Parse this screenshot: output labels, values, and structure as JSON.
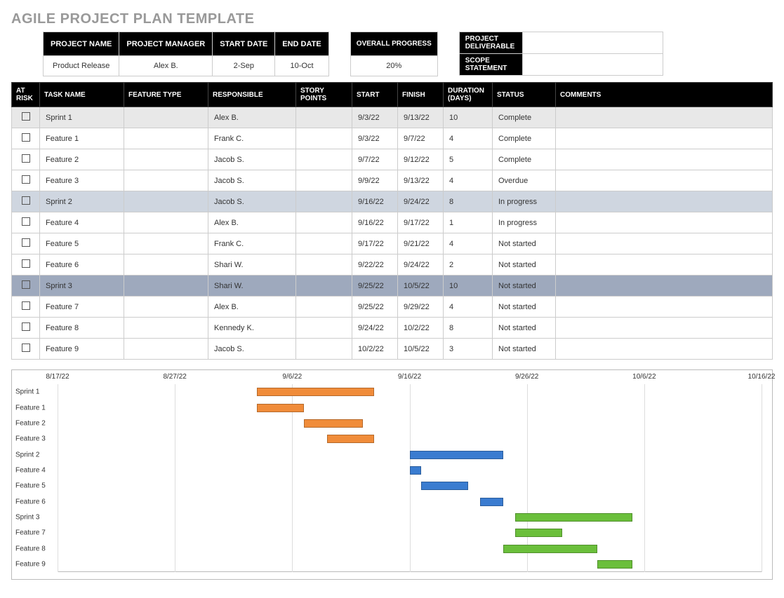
{
  "title": "AGILE PROJECT PLAN TEMPLATE",
  "info": {
    "headers": {
      "project_name": "PROJECT NAME",
      "project_manager": "PROJECT MANAGER",
      "start_date": "START DATE",
      "end_date": "END DATE"
    },
    "project_name": "Product Release",
    "project_manager": "Alex B.",
    "start_date": "2-Sep",
    "end_date": "10-Oct",
    "overall_label": "OVERALL PROGRESS",
    "overall_value": "20%",
    "deliverable_label": "PROJECT DELIVERABLE",
    "deliverable_value": "",
    "scope_label": "SCOPE STATEMENT",
    "scope_value": ""
  },
  "columns": {
    "at_risk": "AT RISK",
    "task_name": "TASK NAME",
    "feature_type": "FEATURE TYPE",
    "responsible": "RESPONSIBLE",
    "story_points": "STORY POINTS",
    "start": "START",
    "finish": "FINISH",
    "duration": "DURATION (DAYS)",
    "status": "STATUS",
    "comments": "COMMENTS"
  },
  "tasks": [
    {
      "cls": "sprint1",
      "task": "Sprint 1",
      "ftype": "",
      "resp": "Alex B.",
      "sp": "",
      "start": "9/3/22",
      "finish": "9/13/22",
      "dur": "10",
      "status": "Complete",
      "comments": ""
    },
    {
      "cls": "",
      "task": "Feature 1",
      "ftype": "",
      "resp": "Frank C.",
      "sp": "",
      "start": "9/3/22",
      "finish": "9/7/22",
      "dur": "4",
      "status": "Complete",
      "comments": ""
    },
    {
      "cls": "",
      "task": "Feature 2",
      "ftype": "",
      "resp": "Jacob S.",
      "sp": "",
      "start": "9/7/22",
      "finish": "9/12/22",
      "dur": "5",
      "status": "Complete",
      "comments": ""
    },
    {
      "cls": "",
      "task": "Feature 3",
      "ftype": "",
      "resp": "Jacob S.",
      "sp": "",
      "start": "9/9/22",
      "finish": "9/13/22",
      "dur": "4",
      "status": "Overdue",
      "comments": ""
    },
    {
      "cls": "sprint2",
      "task": "Sprint 2",
      "ftype": "",
      "resp": "Jacob S.",
      "sp": "",
      "start": "9/16/22",
      "finish": "9/24/22",
      "dur": "8",
      "status": "In progress",
      "comments": ""
    },
    {
      "cls": "",
      "task": "Feature 4",
      "ftype": "",
      "resp": "Alex B.",
      "sp": "",
      "start": "9/16/22",
      "finish": "9/17/22",
      "dur": "1",
      "status": "In progress",
      "comments": ""
    },
    {
      "cls": "",
      "task": "Feature 5",
      "ftype": "",
      "resp": "Frank C.",
      "sp": "",
      "start": "9/17/22",
      "finish": "9/21/22",
      "dur": "4",
      "status": "Not started",
      "comments": ""
    },
    {
      "cls": "",
      "task": "Feature 6",
      "ftype": "",
      "resp": "Shari W.",
      "sp": "",
      "start": "9/22/22",
      "finish": "9/24/22",
      "dur": "2",
      "status": "Not started",
      "comments": ""
    },
    {
      "cls": "sprint3",
      "task": "Sprint 3",
      "ftype": "",
      "resp": "Shari W.",
      "sp": "",
      "start": "9/25/22",
      "finish": "10/5/22",
      "dur": "10",
      "status": "Not started",
      "comments": ""
    },
    {
      "cls": "",
      "task": "Feature 7",
      "ftype": "",
      "resp": "Alex B.",
      "sp": "",
      "start": "9/25/22",
      "finish": "9/29/22",
      "dur": "4",
      "status": "Not started",
      "comments": ""
    },
    {
      "cls": "",
      "task": "Feature 8",
      "ftype": "",
      "resp": "Kennedy K.",
      "sp": "",
      "start": "9/24/22",
      "finish": "10/2/22",
      "dur": "8",
      "status": "Not started",
      "comments": ""
    },
    {
      "cls": "",
      "task": "Feature 9",
      "ftype": "",
      "resp": "Jacob S.",
      "sp": "",
      "start": "10/2/22",
      "finish": "10/5/22",
      "dur": "3",
      "status": "Not started",
      "comments": ""
    }
  ],
  "chart_data": {
    "type": "gantt",
    "x_axis": {
      "min": "8/17/22",
      "max": "10/16/22",
      "ticks": [
        "8/17/22",
        "8/27/22",
        "9/6/22",
        "9/16/22",
        "9/26/22",
        "10/6/22",
        "10/16/22"
      ]
    },
    "colors": {
      "orange": "#f08c3a",
      "blue": "#3a7cd0",
      "green": "#6bbf3b"
    },
    "bars": [
      {
        "label": "Sprint 1",
        "start": "9/3/22",
        "end": "9/13/22",
        "color": "orange"
      },
      {
        "label": "Feature 1",
        "start": "9/3/22",
        "end": "9/7/22",
        "color": "orange"
      },
      {
        "label": "Feature 2",
        "start": "9/7/22",
        "end": "9/12/22",
        "color": "orange"
      },
      {
        "label": "Feature 3",
        "start": "9/9/22",
        "end": "9/13/22",
        "color": "orange"
      },
      {
        "label": "Sprint 2",
        "start": "9/16/22",
        "end": "9/24/22",
        "color": "blue"
      },
      {
        "label": "Feature 4",
        "start": "9/16/22",
        "end": "9/17/22",
        "color": "blue"
      },
      {
        "label": "Feature 5",
        "start": "9/17/22",
        "end": "9/21/22",
        "color": "blue"
      },
      {
        "label": "Feature 6",
        "start": "9/22/22",
        "end": "9/24/22",
        "color": "blue"
      },
      {
        "label": "Sprint 3",
        "start": "9/25/22",
        "end": "10/5/22",
        "color": "green"
      },
      {
        "label": "Feature 7",
        "start": "9/25/22",
        "end": "9/29/22",
        "color": "green"
      },
      {
        "label": "Feature 8",
        "start": "9/24/22",
        "end": "10/2/22",
        "color": "green"
      },
      {
        "label": "Feature 9",
        "start": "10/2/22",
        "end": "10/5/22",
        "color": "green"
      }
    ]
  }
}
